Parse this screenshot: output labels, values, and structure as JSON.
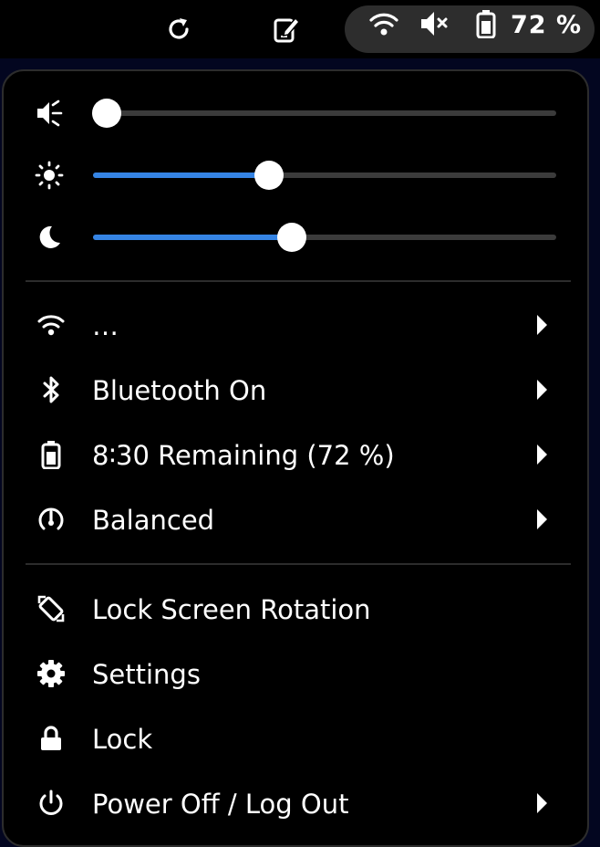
{
  "topbar": {
    "icons": [
      "refresh-icon",
      "note-icon"
    ],
    "status": {
      "icons": [
        "wifi-icon",
        "volume-muted-icon",
        "battery-icon"
      ],
      "battery_percent": "72 %"
    }
  },
  "sliders": [
    {
      "name": "volume",
      "icon": "volume-muted-icon",
      "level": 0.03
    },
    {
      "name": "brightness",
      "icon": "brightness-icon",
      "level": 0.38
    },
    {
      "name": "night-light",
      "icon": "moon-icon",
      "level": 0.43
    }
  ],
  "accent_color": "#3584e4",
  "menu": {
    "wifi": {
      "label": "…"
    },
    "bluetooth": {
      "label": "Bluetooth On"
    },
    "battery": {
      "label": "8∶30 Remaining (72 %)"
    },
    "power_mode": {
      "label": "Balanced"
    },
    "rotation": {
      "label": "Lock Screen Rotation"
    },
    "settings": {
      "label": "Settings"
    },
    "lock": {
      "label": "Lock"
    },
    "power": {
      "label": "Power Off / Log Out"
    }
  }
}
